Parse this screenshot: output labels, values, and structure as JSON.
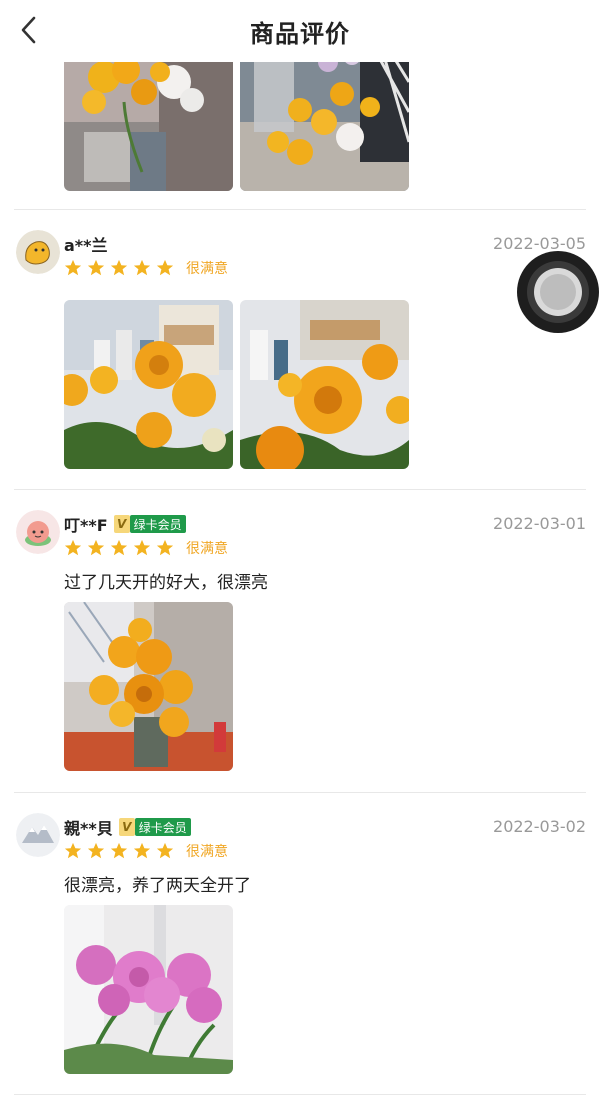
{
  "header": {
    "title": "商品评价",
    "back_icon": "chevron-left-icon"
  },
  "reviews": [
    {
      "username": "a**兰",
      "date": "2022-03-05",
      "rating": 5,
      "rating_label": "很满意",
      "vip": "",
      "member_label": "",
      "comment": "",
      "avatar_icon": "yellow-blob-avatar"
    },
    {
      "username": "叮**F",
      "date": "2022-03-01",
      "rating": 5,
      "rating_label": "很满意",
      "vip": "V",
      "member_label": "绿卡会员",
      "comment": "过了几天开的好大，很漂亮",
      "avatar_icon": "peach-avatar"
    },
    {
      "username": "親**貝",
      "date": "2022-03-02",
      "rating": 5,
      "rating_label": "很满意",
      "vip": "V",
      "member_label": "绿卡会员",
      "comment": "很漂亮，养了两天全开了",
      "avatar_icon": "mountain-avatar"
    }
  ],
  "colors": {
    "star": "#f3b320",
    "member_badge": "#1f9a4a",
    "vip_badge": "#f6d77a",
    "rating_label": "#f0a623"
  },
  "floating_button_icon": "assistive-touch-icon"
}
